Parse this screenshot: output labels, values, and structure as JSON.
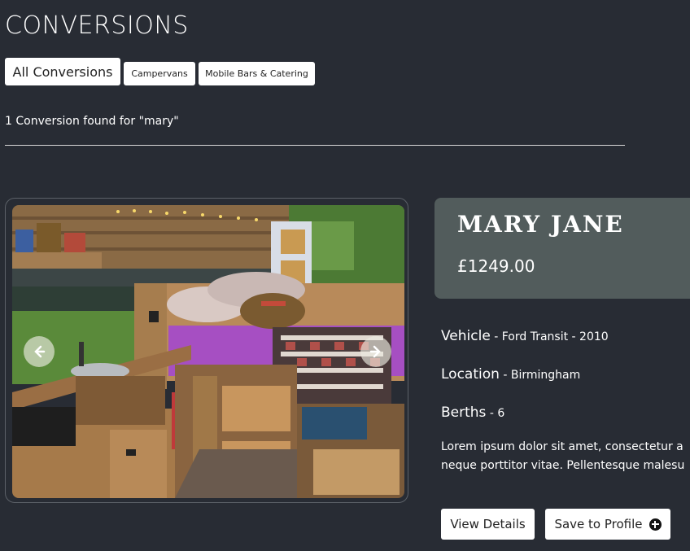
{
  "page": {
    "title": "CONVERSIONS"
  },
  "filters": {
    "all_label": "All Conversions",
    "campervans_label": "Campervans",
    "bars_label": "Mobile Bars & Catering"
  },
  "search": {
    "results_text": "1 Conversion found for \"mary\""
  },
  "listing": {
    "name": "MARY JANE",
    "price": "£1249.00",
    "vehicle_label": "Vehicle",
    "vehicle_value": " - Ford Transit - 2010",
    "location_label": "Location",
    "location_value": " - Birmingham",
    "berths_label": "Berths",
    "berths_value": " - 6",
    "description_line1": "Lorem ipsum dolor sit amet, consectetur a",
    "description_line2": "neque porttitor vitae. Pellentesque malesu",
    "view_details_label": "View Details",
    "save_label": "Save to Profile"
  },
  "icons": {
    "prev": "arrow-left-icon",
    "next": "arrow-right-icon",
    "save": "plus-circle-icon"
  },
  "colors": {
    "background": "#282c34",
    "info_panel": "#525c5c",
    "button_bg": "#ffffff"
  }
}
